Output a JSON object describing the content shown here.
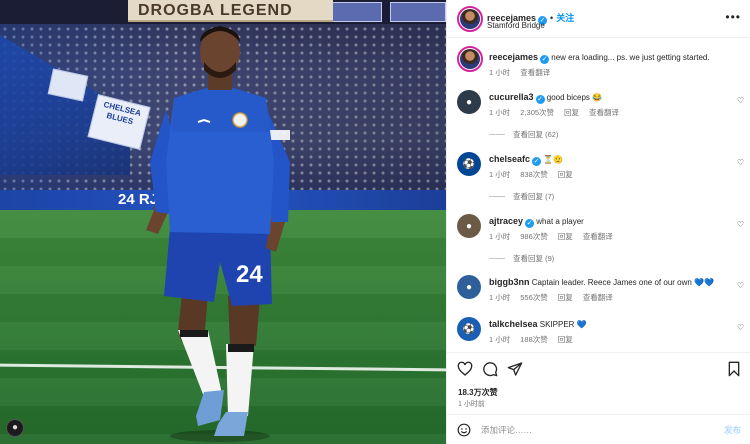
{
  "photo": {
    "banner_text": "DROGBA LEGEND",
    "adboard_text": "24 RJ",
    "jersey_number": "24",
    "flag_text": "CHELSEA BLUES"
  },
  "post": {
    "author": "reecejames",
    "follow_label": "关注",
    "location": "Stamford Bridge",
    "caption": "new era loading... ps. we just getting started.",
    "caption_time": "1 小时",
    "caption_translate": "查看翻译",
    "likes": "18.3万次赞",
    "posted_time": "1 小时前"
  },
  "comments": [
    {
      "user": "cucurella3",
      "verified": true,
      "text": "good biceps 😂",
      "time": "1 小时",
      "likes": "2,305次赞",
      "reply": "回复",
      "translate": "查看翻译",
      "replies_label": "查看回复 (62)",
      "avatar_color": "#2d3a4a"
    },
    {
      "user": "chelseafc",
      "verified": true,
      "text": "⏳🫡",
      "time": "1 小时",
      "likes": "838次赞",
      "reply": "回复",
      "translate": "",
      "replies_label": "查看回复 (7)",
      "avatar_color": "#034694"
    },
    {
      "user": "ajtracey",
      "verified": true,
      "text": "what a player",
      "time": "1 小时",
      "likes": "986次赞",
      "reply": "回复",
      "translate": "查看翻译",
      "replies_label": "查看回复 (9)",
      "avatar_color": "#6b5a45"
    },
    {
      "user": "biggb3nn",
      "verified": false,
      "text": "Captain leader. Reece James one of our own 💙💙",
      "time": "1 小时",
      "likes": "556次赞",
      "reply": "回复",
      "translate": "查看翻译",
      "replies_label": "",
      "avatar_color": "#2f5f9a"
    },
    {
      "user": "talkchelsea",
      "verified": false,
      "text": "SKIPPER 💙",
      "time": "1 小时",
      "likes": "188次赞",
      "reply": "回复",
      "translate": "",
      "replies_label": "",
      "avatar_color": "#1a5fb4"
    }
  ],
  "composer": {
    "placeholder": "添加评论……",
    "post_label": "发布"
  },
  "icons": {
    "like": "heart-icon",
    "comment": "comment-icon",
    "share": "paper-plane-icon",
    "save": "bookmark-icon",
    "emoji": "smiley-icon",
    "more": "more-dots-icon"
  },
  "colors": {
    "accent": "#0095f6",
    "verified": "#1d9bf0",
    "muted": "#737373"
  }
}
